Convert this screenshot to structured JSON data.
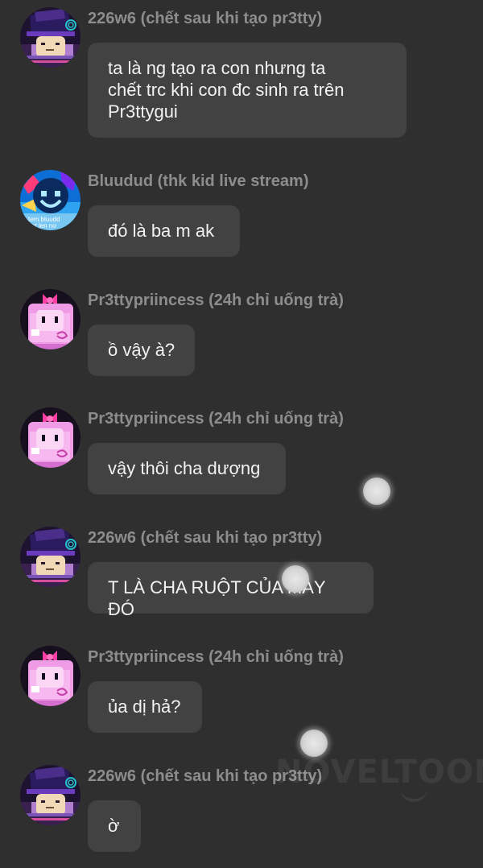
{
  "messages": [
    {
      "author": "226w6 (chết sau khi tạo pr3tty)",
      "text": "ta là ng tạo ra con nhưng ta\nchết trc khi con đc sinh ra trên\nPr3ttygui",
      "avatar": "purple-hat-avatar-icon"
    },
    {
      "author": "Bluudud (thk kid live stream)",
      "text": "đó là ba m ak",
      "avatar": "blue-smiley-avatar-icon"
    },
    {
      "author": "Pr3ttypriincess (24h chỉ uống trà)",
      "text": "ồ vậy à?",
      "avatar": "pink-bow-avatar-icon"
    },
    {
      "author": "Pr3ttypriincess (24h chỉ uống trà)",
      "text": "vậy thôi cha dượng",
      "avatar": "pink-bow-avatar-icon"
    },
    {
      "author": "226w6 (chết sau khi tạo pr3tty)",
      "text": "T LÀ CHA RUỘT CỦA MÀY ĐÓ",
      "avatar": "purple-hat-avatar-icon"
    },
    {
      "author": "Pr3ttypriincess (24h chỉ uống trà)",
      "text": "ủa dị hả?",
      "avatar": "pink-bow-avatar-icon"
    },
    {
      "author": "226w6 (chết sau khi tạo pr3tty)",
      "text": "ờ",
      "avatar": "purple-hat-avatar-icon"
    }
  ],
  "watermark": "NOVELTOON",
  "colors": {
    "background": "#2f2f2f",
    "bubble": "#424242",
    "author_text": "#8d8d8d",
    "message_text": "#f2f2f2"
  }
}
